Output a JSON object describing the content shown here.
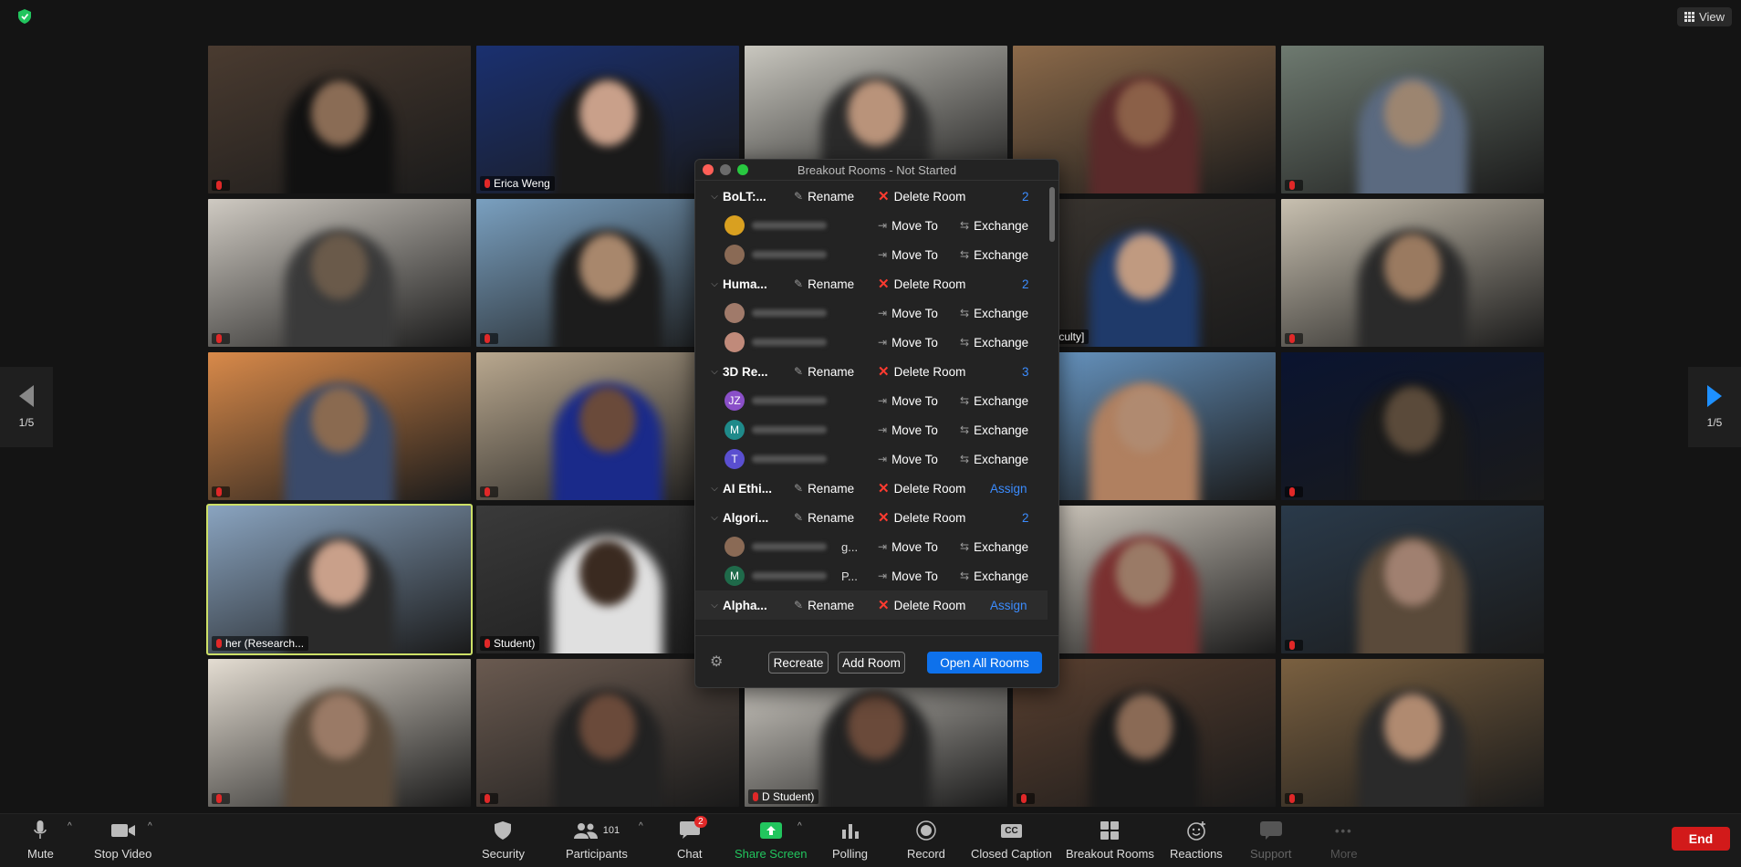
{
  "app": {
    "view_label": "View"
  },
  "gallery": {
    "page_left": "1/5",
    "page_right": "1/5",
    "tiles": [
      {
        "name": "",
        "bg": "#4a3b30",
        "skin": "#8a6c55",
        "shirt": "#111"
      },
      {
        "name": "Erica Weng",
        "bg": "#1a3070",
        "skin": "#c9a08a",
        "shirt": "#1a1a1a"
      },
      {
        "name": "",
        "bg": "#c9c7bf",
        "skin": "#b9937a",
        "shirt": "#2a2a2a"
      },
      {
        "name": "",
        "bg": "#8c6a4a",
        "skin": "#8b6048",
        "shirt": "#5a2a2a"
      },
      {
        "name": "",
        "bg": "#6e7a70",
        "skin": "#9c8570",
        "shirt": "#5b6a80"
      },
      {
        "name": "",
        "bg": "#cfcac2",
        "skin": "#6a5a4a",
        "shirt": "#3a3a3a"
      },
      {
        "name": "",
        "bg": "#7aa0c0",
        "skin": "#a8876c",
        "shirt": "#1c1c1c"
      },
      {
        "name": "",
        "bg": "#5a4a3a",
        "skin": "#8a6a55",
        "shirt": "#222"
      },
      {
        "name": "n) [Faculty]",
        "bg": "#3a3530",
        "skin": "#c09a80",
        "shirt": "#1f3a6a"
      },
      {
        "name": "",
        "bg": "#c8c0b0",
        "skin": "#9a7a60",
        "shirt": "#2a2a2a"
      },
      {
        "name": "",
        "bg": "#d98a4a",
        "skin": "#8a6a50",
        "shirt": "#3a4a6a"
      },
      {
        "name": "",
        "bg": "#b9a88f",
        "skin": "#6a4a3a",
        "shirt": "#1a2a8a"
      },
      {
        "name": "",
        "bg": "#3a3530",
        "skin": "#8a6a55",
        "shirt": "#222"
      },
      {
        "name": "",
        "bg": "#6a9ac8",
        "skin": "#b08a70",
        "shirt": "#b08060"
      },
      {
        "name": "",
        "bg": "#0a1430",
        "skin": "#5a4a3a",
        "shirt": "#1a1a1a"
      },
      {
        "name": "her (Research...",
        "bg": "#8aa4c0",
        "skin": "#c9a08a",
        "shirt": "#2a2a2a"
      },
      {
        "name": "Student)",
        "bg": "#3a3a3a",
        "skin": "#3a2a20",
        "shirt": "#e0e0e0"
      },
      {
        "name": "",
        "bg": "#2a2520",
        "skin": "#8a6a55",
        "shirt": "#222"
      },
      {
        "name": "",
        "bg": "#d6cfc4",
        "skin": "#9a7a66",
        "shirt": "#7a3030"
      },
      {
        "name": "",
        "bg": "#2a3a4a",
        "skin": "#a08070",
        "shirt": "#5a4a3a"
      },
      {
        "name": "",
        "bg": "#e4ddd2",
        "skin": "#9a7a66",
        "shirt": "#5a4a3a"
      },
      {
        "name": "",
        "bg": "#6a5a50",
        "skin": "#6a4a3a",
        "shirt": "#222"
      },
      {
        "name": "D Student)",
        "bg": "#d8d4cc",
        "skin": "#6a4a3a",
        "shirt": "#222"
      },
      {
        "name": "",
        "bg": "#5a4030",
        "skin": "#8a6a55",
        "shirt": "#1a1a1a"
      },
      {
        "name": "",
        "bg": "#7a6040",
        "skin": "#b08a70",
        "shirt": "#2a2a2a"
      }
    ]
  },
  "breakout": {
    "title": "Breakout Rooms - Not Started",
    "rename_label": "Rename",
    "delete_label": "Delete Room",
    "move_label": "Move To",
    "exchange_label": "Exchange",
    "assign_label": "Assign",
    "rooms": [
      {
        "name": "BoLT:...",
        "count": "2",
        "members": [
          {
            "initials": "",
            "color": "#d9a020"
          },
          {
            "initials": "",
            "color": "#8a6a55"
          }
        ]
      },
      {
        "name": "Huma...",
        "count": "2",
        "members": [
          {
            "initials": "",
            "color": "#a07a6a"
          },
          {
            "initials": "",
            "color": "#c08a7a"
          }
        ]
      },
      {
        "name": "3D Re...",
        "count": "3",
        "members": [
          {
            "initials": "JZ",
            "color": "#8a4fc8"
          },
          {
            "initials": "M",
            "color": "#1f8a8a"
          },
          {
            "initials": "T",
            "color": "#5a4fd0"
          }
        ]
      },
      {
        "name": "AI Ethi...",
        "count": "",
        "members": []
      },
      {
        "name": "Algori...",
        "count": "2",
        "members": [
          {
            "initials": "",
            "color": "#8a6a55",
            "suffix": "g..."
          },
          {
            "initials": "M",
            "color": "#1f6a4a",
            "suffix": "P..."
          }
        ]
      },
      {
        "name": "Alpha...",
        "count": "",
        "members": []
      }
    ],
    "footer": {
      "recreate": "Recreate",
      "add_room": "Add Room",
      "open_all": "Open All Rooms"
    }
  },
  "toolbar": {
    "mute": "Mute",
    "stop_video": "Stop Video",
    "security": "Security",
    "participants": "Participants",
    "participants_count": "101",
    "chat": "Chat",
    "chat_badge": "2",
    "share_screen": "Share Screen",
    "polling": "Polling",
    "record": "Record",
    "closed_caption": "Closed Caption",
    "breakout_rooms": "Breakout Rooms",
    "reactions": "Reactions",
    "support": "Support",
    "more": "More",
    "end": "End"
  }
}
